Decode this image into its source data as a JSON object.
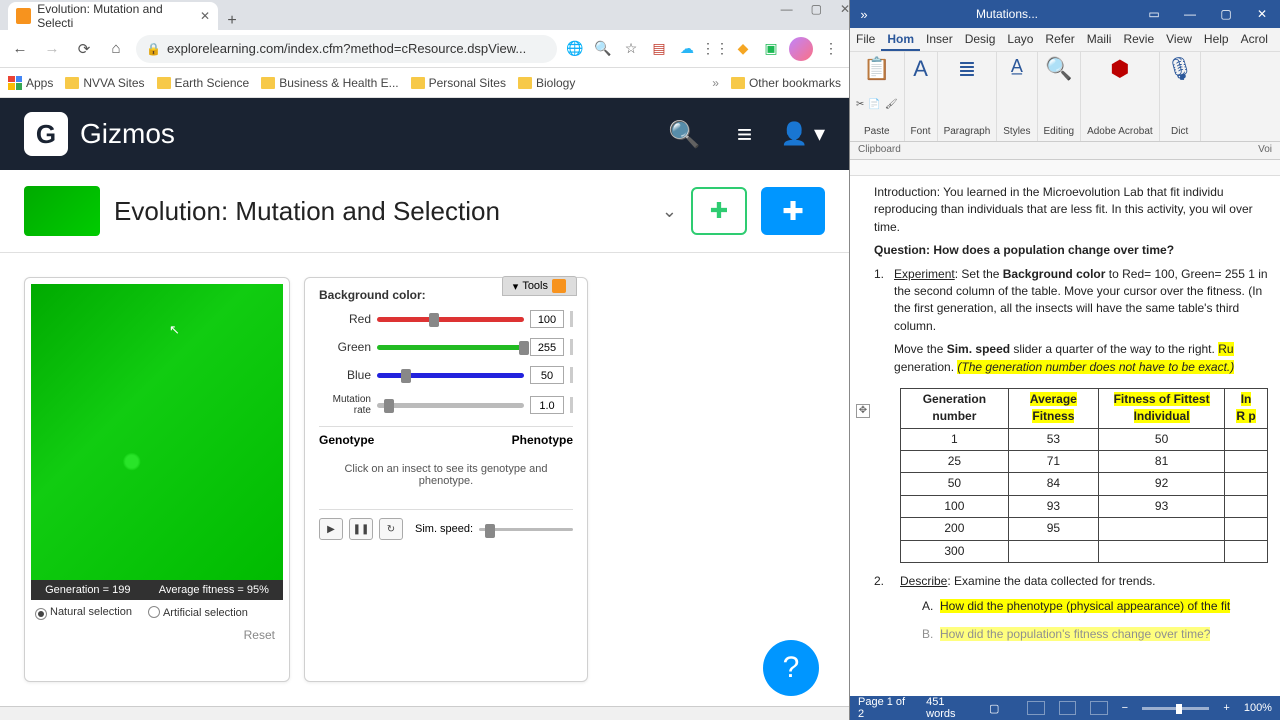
{
  "chrome": {
    "tab_title": "Evolution: Mutation and Selecti",
    "url": "explorelearning.com/index.cfm?method=cResource.dspView...",
    "bookmarks": [
      "Apps",
      "NVVA Sites",
      "Earth Science",
      "Business & Health E...",
      "Personal Sites",
      "Biology"
    ],
    "other_bookmarks": "Other bookmarks"
  },
  "gizmos": {
    "brand": "Gizmos",
    "logo_letter": "G",
    "page_title": "Evolution: Mutation and Selection"
  },
  "sim": {
    "status_gen_label": "Generation = 199",
    "status_fit_label": "Average fitness = 95%",
    "mode_natural": "Natural selection",
    "mode_artificial": "Artificial selection",
    "reset": "Reset"
  },
  "controls": {
    "tools": "Tools",
    "bg_label": "Background color:",
    "red": {
      "label": "Red",
      "value": "100",
      "pct": 39
    },
    "green": {
      "label": "Green",
      "value": "255",
      "pct": 100
    },
    "blue": {
      "label": "Blue",
      "value": "50",
      "pct": 20
    },
    "mutation": {
      "label": "Mutation rate",
      "value": "1.0",
      "pct": 8
    },
    "genotype": "Genotype",
    "phenotype": "Phenotype",
    "hint": "Click on an insect to see its genotype and phenotype.",
    "sim_speed": "Sim. speed:"
  },
  "word": {
    "title": "Mutations...",
    "menus": [
      "File",
      "Hom",
      "Inser",
      "Desig",
      "Layo",
      "Refer",
      "Maili",
      "Revie",
      "View",
      "Help",
      "Acrol"
    ],
    "ribbon": [
      "Paste",
      "Font",
      "Paragraph",
      "Styles",
      "Editing",
      "Adobe Acrobat",
      "Dict"
    ],
    "clipboard": "Clipboard",
    "voice": "Voi",
    "intro": "Introduction: You learned in the Microevolution Lab that fit individu reproducing than individuals that are less fit. In this activity, you wil over time.",
    "question": "Question: How does a population change over time?",
    "step1_lead": "Experiment",
    "step1_a": ": Set the ",
    "step1_b": "Background color",
    "step1_c": " to Red= 100, Green= 255 1 in the second column of the table. Move your cursor over the fitness. (In the first generation, all the insects will have the same table's third column.",
    "step1_move": "Move the ",
    "step1_sim": "Sim. speed",
    "step1_tail": " slider a quarter of the way to the right. ",
    "step1_hl1": "Ru",
    "step1_gen": "generation. ",
    "step1_hl2": "(The generation number does not have to be exact.)",
    "step2_lead": "Describe",
    "step2_tail": ": Examine the data collected for trends.",
    "qa": "How did the phenotype (physical appearance) of the fit",
    "qb": "How did the population's fitness change over time?",
    "status_page": "Page 1 of 2",
    "status_words": "451 words",
    "status_zoom": "100%",
    "table": {
      "h1": "Generation number",
      "h2": "Average Fitness",
      "h3": "Fitness of Fittest Individual",
      "h4": "In R p",
      "rows": [
        {
          "g": "1",
          "af": "53",
          "ff": "50"
        },
        {
          "g": "25",
          "af": "71",
          "ff": "81"
        },
        {
          "g": "50",
          "af": "84",
          "ff": "92"
        },
        {
          "g": "100",
          "af": "93",
          "ff": "93"
        },
        {
          "g": "200",
          "af": "95",
          "ff": ""
        },
        {
          "g": "300",
          "af": "",
          "ff": ""
        }
      ]
    }
  },
  "chart_data": {
    "type": "table",
    "title": "Fitness by generation",
    "columns": [
      "Generation number",
      "Average Fitness",
      "Fitness of Fittest Individual"
    ],
    "rows": [
      [
        1,
        53,
        50
      ],
      [
        25,
        71,
        81
      ],
      [
        50,
        84,
        92
      ],
      [
        100,
        93,
        93
      ],
      [
        200,
        95,
        null
      ],
      [
        300,
        null,
        null
      ]
    ]
  }
}
